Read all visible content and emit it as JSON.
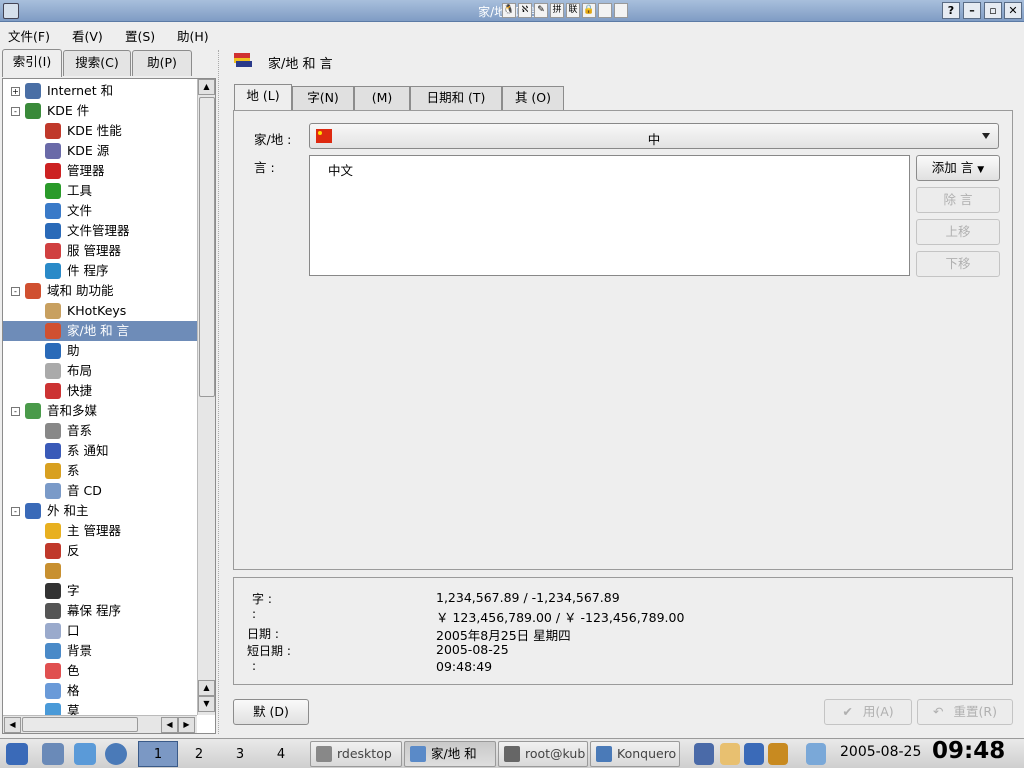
{
  "window": {
    "title": "家/地 和 言 -"
  },
  "menubar": [
    "文件(F)",
    "看(V)",
    "置(S)",
    "助(H)"
  ],
  "left_tabs": [
    "索引(I)",
    "搜索(C)",
    "助(P)"
  ],
  "tree": [
    {
      "label": "Internet 和",
      "level": 0,
      "expander": "+",
      "icon": "globe-icon",
      "color": "#4a6fa5"
    },
    {
      "label": "KDE  件",
      "level": 0,
      "expander": "-",
      "icon": "kde-components-icon",
      "color": "#3a8a3a"
    },
    {
      "label": "KDE 性能",
      "level": 1,
      "icon": "rocket-icon",
      "color": "#c0392b"
    },
    {
      "label": "KDE  源",
      "level": 1,
      "icon": "resources-icon",
      "color": "#6a6aa8"
    },
    {
      "label": "  管理器",
      "level": 1,
      "icon": "power-icon",
      "color": "#cc2222"
    },
    {
      "label": "    工具",
      "level": 1,
      "icon": "spellcheck-icon",
      "color": "#2a9a2a"
    },
    {
      "label": "文件",
      "level": 1,
      "icon": "speech-bubble-icon",
      "color": "#3a7ac8"
    },
    {
      "label": "文件管理器",
      "level": 1,
      "icon": "cube-icon",
      "color": "#2a6ab8"
    },
    {
      "label": "服 管理器",
      "level": 1,
      "icon": "pin-icon",
      "color": "#d04040"
    },
    {
      "label": "件  程序",
      "level": 1,
      "icon": "gear-icon",
      "color": "#2a8ac8"
    },
    {
      "label": "  域和 助功能",
      "level": 0,
      "expander": "-",
      "icon": "flags-icon",
      "color": "#d05030"
    },
    {
      "label": "KHotKeys",
      "level": 1,
      "icon": "keyboard-icon",
      "color": "#c8a060"
    },
    {
      "label": "  家/地  和  言",
      "level": 1,
      "icon": "flags-icon",
      "color": "#d05030",
      "selected": true
    },
    {
      "label": "助",
      "level": 1,
      "icon": "accessibility-icon",
      "color": "#2a6ab8"
    },
    {
      "label": "  布局",
      "level": 1,
      "icon": "layout-icon",
      "color": "#aaaaaa"
    },
    {
      "label": "  快捷",
      "level": 1,
      "icon": "shortcut-icon",
      "color": "#cc3333"
    },
    {
      "label": "  音和多媒",
      "level": 0,
      "expander": "-",
      "icon": "speaker-icon",
      "color": "#4a9a4a"
    },
    {
      "label": "  音系",
      "level": 1,
      "icon": "disc-icon",
      "color": "#888888"
    },
    {
      "label": "系 通知",
      "level": 1,
      "icon": "music-note-icon",
      "color": "#3a5ab8"
    },
    {
      "label": "系",
      "level": 1,
      "icon": "bell-icon",
      "color": "#d8a020"
    },
    {
      "label": "音  CD",
      "level": 1,
      "icon": "cd-icon",
      "color": "#7a9ac8"
    },
    {
      "label": "外  和主",
      "level": 0,
      "expander": "-",
      "icon": "appearance-icon",
      "color": "#3a6ab8"
    },
    {
      "label": "主 管理器",
      "level": 1,
      "icon": "theme-icon",
      "color": "#e8b020"
    },
    {
      "label": "  反",
      "level": 1,
      "icon": "rocket-icon",
      "color": "#c0392b"
    },
    {
      "label": "",
      "level": 1,
      "icon": "style-icon",
      "color": "#c89030"
    },
    {
      "label": "字",
      "level": 1,
      "icon": "font-icon",
      "color": "#333333"
    },
    {
      "label": "幕保 程序",
      "level": 1,
      "icon": "screensaver-icon",
      "color": "#555555"
    },
    {
      "label": "口",
      "level": 1,
      "icon": "window-icon",
      "color": "#9aaacc"
    },
    {
      "label": "背景",
      "level": 1,
      "icon": "background-icon",
      "color": "#4a8ac8"
    },
    {
      "label": "色",
      "level": 1,
      "icon": "color-icon",
      "color": "#e05050"
    },
    {
      "label": "格",
      "level": 1,
      "icon": "style2-icon",
      "color": "#6a9ad8"
    },
    {
      "label": "  莫",
      "level": 1,
      "icon": "more-icon",
      "color": "#4a9ad8"
    }
  ],
  "page": {
    "title": "家/地  和  言"
  },
  "right_tabs": [
    "地 (L)",
    "字(N)",
    "(M)",
    "日期和   (T)",
    "其 (O)"
  ],
  "country_label": "家/地  :",
  "country_value": "中",
  "lang_label": "言  :",
  "languages": [
    "中文"
  ],
  "buttons": {
    "add": "添加 言",
    "remove": "除 言",
    "up": "上移",
    "down": "下移"
  },
  "info": [
    {
      "key": "字 :",
      "value": "1,234,567.89 / -1,234,567.89"
    },
    {
      "key": "  :",
      "value": "￥ 123,456,789.00 / ￥ -123,456,789.00"
    },
    {
      "key": "日期 :",
      "value": "2005年8月25日 星期四"
    },
    {
      "key": "短日期 :",
      "value": "2005-08-25"
    },
    {
      "key": "  :",
      "value": "09:48:49"
    }
  ],
  "bottom_buttons": {
    "default": "默  (D)",
    "apply": "用(A)",
    "reset": "重置(R)"
  },
  "taskbar": {
    "desktops": [
      "1",
      "2",
      "3",
      "4"
    ],
    "tasks": [
      "rdesktop",
      "家/地  和",
      "root@kub",
      "Konquero"
    ],
    "date": "2005-08-25",
    "time": "09:48"
  }
}
